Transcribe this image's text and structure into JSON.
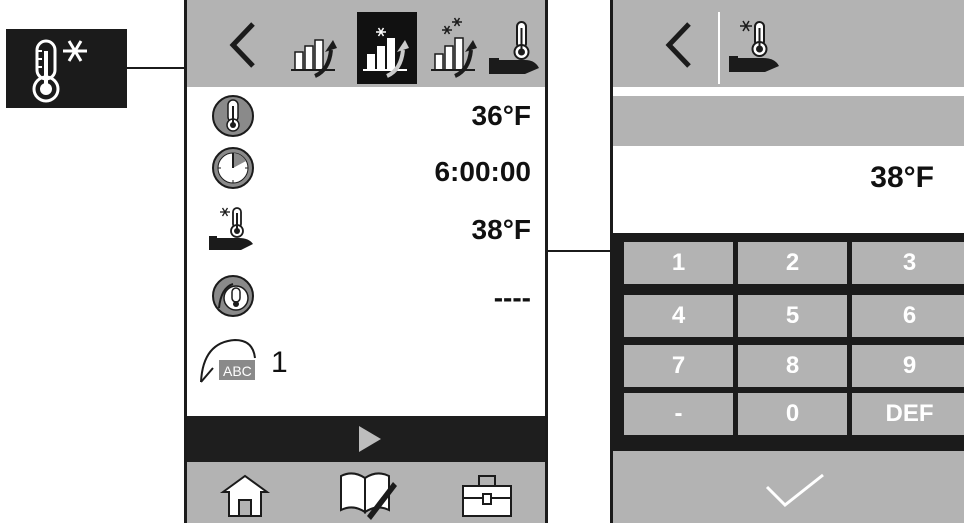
{
  "callout": {
    "icon": "thermometer-snowflake-icon"
  },
  "left_panel": {
    "toolbar": {
      "back_icon": "chevron-left-icon",
      "buttons": [
        {
          "icon": "chart-arrow-icon",
          "active": false
        },
        {
          "icon": "chart-snowflake-arrow-icon",
          "active": true
        },
        {
          "icon": "chart-double-snowflake-arrow-icon",
          "active": false
        },
        {
          "icon": "hand-thermometer-icon",
          "active": false
        }
      ]
    },
    "rows": [
      {
        "icon": "thermometer-circle-icon",
        "value": "36°F"
      },
      {
        "icon": "clock-icon",
        "value": "6:00:00"
      },
      {
        "icon": "hand-thermometer-snowflake-icon",
        "value": "38°F"
      },
      {
        "icon": "probe-circle-icon",
        "value": "----"
      },
      {
        "icon": "probe-abc-icon",
        "label": "ABC",
        "number": "1"
      }
    ],
    "play_icon": "play-icon",
    "bottom": [
      {
        "icon": "home-icon"
      },
      {
        "icon": "book-pencil-icon"
      },
      {
        "icon": "toolbox-icon"
      }
    ]
  },
  "right_panel": {
    "back_icon": "chevron-left-icon",
    "header_icon": "hand-thermometer-snowflake-icon",
    "value": "38°F",
    "keypad": [
      "1",
      "2",
      "3",
      "4",
      "5",
      "6",
      "7",
      "8",
      "9",
      "-",
      "0",
      "DEF"
    ],
    "confirm_icon": "check-icon"
  },
  "colors": {
    "toolbar_gray": "#b3b3b3",
    "dark": "#1b1b1b",
    "key_text": "#ffffff"
  }
}
